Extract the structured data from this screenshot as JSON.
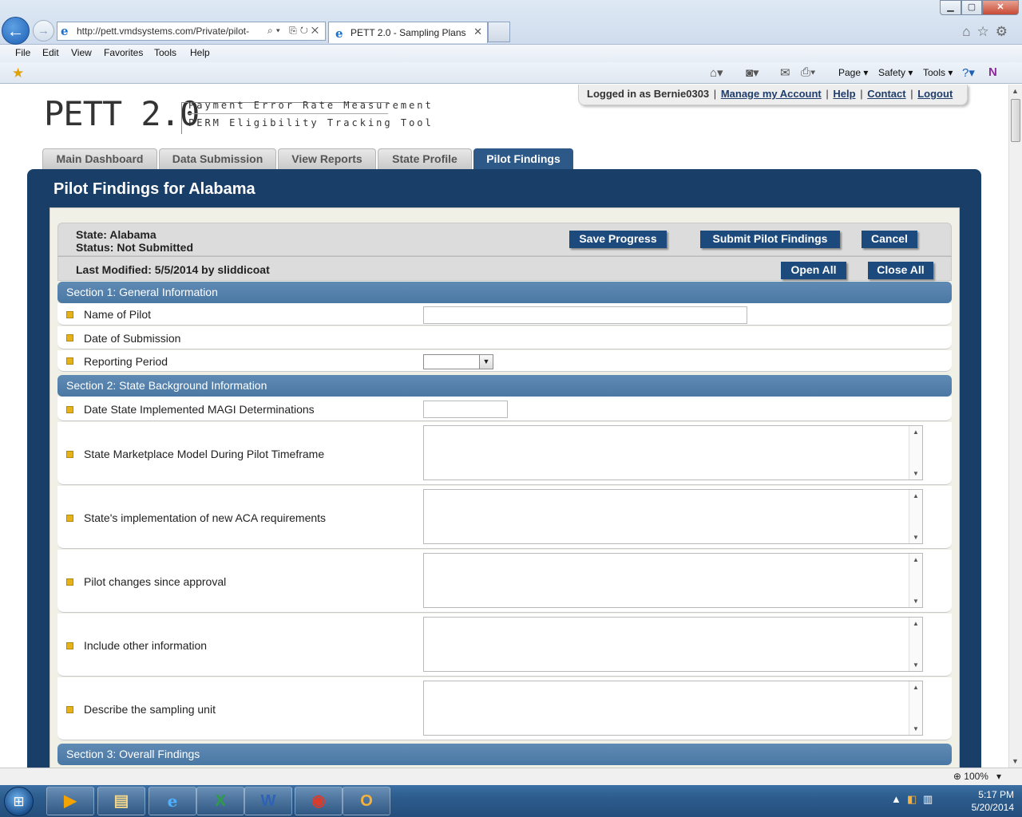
{
  "browser": {
    "url": "http://pett.vmdsystems.com/Private/pilot-",
    "tab_title": "PETT 2.0 - Sampling Plans",
    "menu": [
      "File",
      "Edit",
      "View",
      "Favorites",
      "Tools",
      "Help"
    ],
    "command_bar": {
      "page": "Page",
      "safety": "Safety",
      "tools": "Tools"
    },
    "zoom": "100%"
  },
  "header": {
    "logo_main": "PETT 2.0",
    "logo_line1": "Payment Error Rate Measurement",
    "logo_line2": "PERM Eligibility Tracking Tool",
    "logged_in": "Logged in as Bernie0303",
    "links": {
      "manage": "Manage my Account",
      "help": "Help",
      "contact": "Contact",
      "logout": "Logout"
    }
  },
  "nav_tabs": [
    {
      "label": "Main Dashboard"
    },
    {
      "label": "Data Submission"
    },
    {
      "label": "View Reports"
    },
    {
      "label": "State Profile"
    },
    {
      "label": "Pilot Findings"
    }
  ],
  "panel": {
    "title": "Pilot Findings for Alabama",
    "state": "State: Alabama",
    "status": "Status: Not Submitted",
    "last_modified": "Last Modified: 5/5/2014 by sliddicoat",
    "buttons": {
      "save": "Save Progress",
      "submit": "Submit Pilot Findings",
      "cancel": "Cancel",
      "open_all": "Open All",
      "close_all": "Close All"
    }
  },
  "sections": [
    {
      "title": "Section 1: General Information",
      "fields": [
        {
          "label": "Name of Pilot",
          "value": ""
        },
        {
          "label": "Date of Submission",
          "value": ""
        },
        {
          "label": "Reporting Period",
          "value": ""
        }
      ]
    },
    {
      "title": "Section 2: State Background Information",
      "fields": [
        {
          "label": "Date State Implemented MAGI Determinations",
          "value": ""
        },
        {
          "label": "State Marketplace Model During Pilot Timeframe",
          "value": ""
        },
        {
          "label": "State's implementation of new ACA requirements",
          "value": ""
        },
        {
          "label": "Pilot changes since approval",
          "value": ""
        },
        {
          "label": "Include other information",
          "value": ""
        },
        {
          "label": "Describe the sampling unit",
          "value": ""
        }
      ]
    },
    {
      "title": "Section 3: Overall Findings",
      "fields": []
    }
  ],
  "taskbar": {
    "time": "5:17 PM",
    "date": "5/20/2014"
  }
}
